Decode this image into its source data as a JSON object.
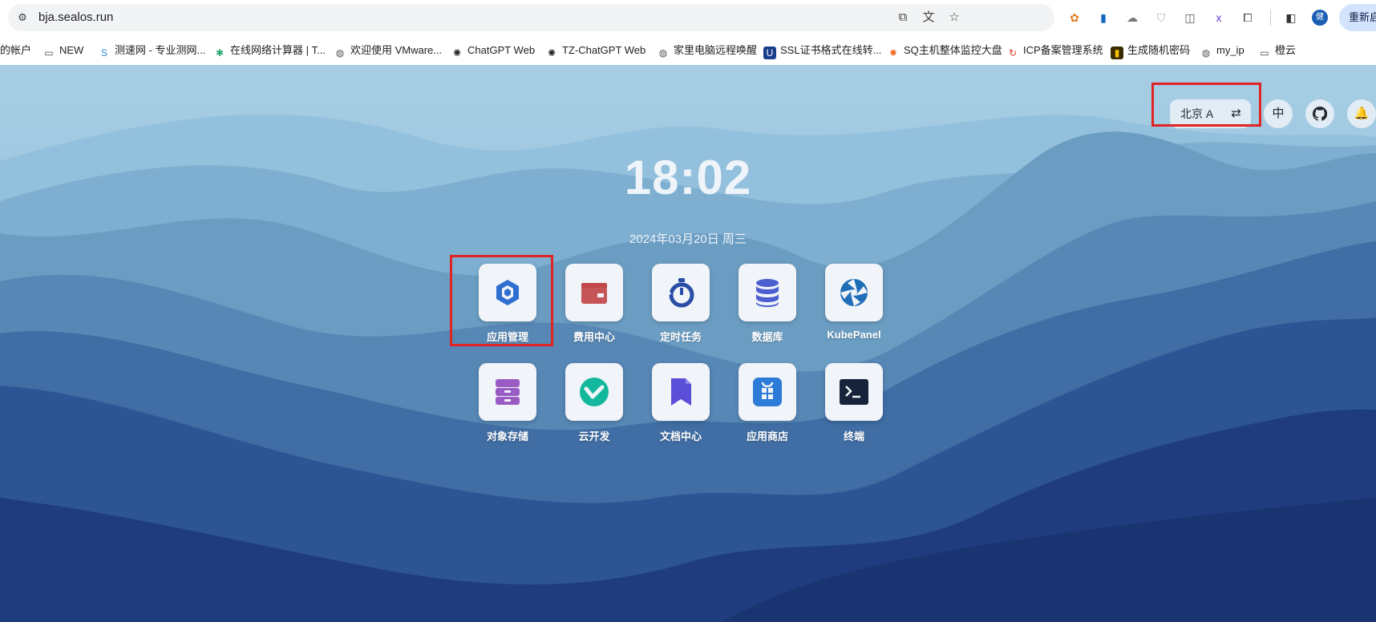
{
  "browser": {
    "url": "bja.sealos.run",
    "relaunch_label": "重新启",
    "profile_initial": "健",
    "bookmarks": [
      {
        "label": "的帐户",
        "icon": "account-icon"
      },
      {
        "label": "NEW",
        "icon": "folder-icon"
      },
      {
        "label": "测速网 - 专业测网...",
        "icon": "speedtest-icon"
      },
      {
        "label": "在线网络计算器 | T...",
        "icon": "calculator-icon"
      },
      {
        "label": "欢迎使用 VMware...",
        "icon": "globe-icon"
      },
      {
        "label": "ChatGPT Web",
        "icon": "openai-icon"
      },
      {
        "label": "TZ-ChatGPT Web",
        "icon": "openai-icon"
      },
      {
        "label": "家里电脑远程唤醒",
        "icon": "globe-icon"
      },
      {
        "label": "SSL证书格式在线转...",
        "icon": "ssl-icon"
      },
      {
        "label": "SQ主机整体监控大盘",
        "icon": "grafana-icon"
      },
      {
        "label": "ICP备案管理系统",
        "icon": "icp-icon"
      },
      {
        "label": "生成随机密码",
        "icon": "password-icon"
      },
      {
        "label": "my_ip",
        "icon": "globe-icon"
      },
      {
        "label": "橙云",
        "icon": "folder-icon"
      }
    ]
  },
  "desktop": {
    "region_label": "北京 A",
    "lang_label": "中",
    "clock": "18:02",
    "date": "2024年03月20日 周三",
    "apps": [
      {
        "label": "应用管理",
        "icon": "app-management-icon"
      },
      {
        "label": "费用中心",
        "icon": "wallet-icon"
      },
      {
        "label": "定时任务",
        "icon": "timer-icon"
      },
      {
        "label": "数据库",
        "icon": "database-icon"
      },
      {
        "label": "KubePanel",
        "icon": "kubepanel-icon"
      },
      {
        "label": "对象存储",
        "icon": "storage-icon"
      },
      {
        "label": "云开发",
        "icon": "cloud-dev-icon"
      },
      {
        "label": "文档中心",
        "icon": "docs-icon"
      },
      {
        "label": "应用商店",
        "icon": "app-store-icon"
      },
      {
        "label": "终端",
        "icon": "terminal-icon"
      }
    ],
    "colors": {
      "highlight": "#e02424",
      "tile": "#f1f4f8"
    }
  }
}
